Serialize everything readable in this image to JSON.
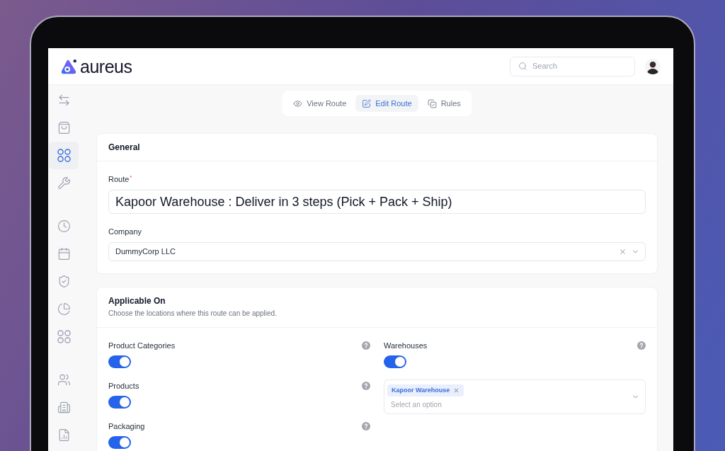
{
  "header": {
    "brand": "aureus",
    "search": {
      "placeholder": "Search"
    }
  },
  "sidebar": {
    "groups": [
      {
        "items": [
          {
            "selected": false
          },
          {
            "selected": false
          },
          {
            "selected": true
          },
          {
            "selected": false
          }
        ]
      },
      {
        "items": [
          {
            "selected": false
          },
          {
            "selected": false
          },
          {
            "selected": false
          },
          {
            "selected": false
          },
          {
            "selected": false
          }
        ]
      },
      {
        "items": [
          {
            "selected": false
          },
          {
            "selected": false
          },
          {
            "selected": false
          }
        ]
      }
    ]
  },
  "tabs": [
    {
      "label": "View Route",
      "selected": false
    },
    {
      "label": "Edit Route",
      "selected": true
    },
    {
      "label": "Rules",
      "selected": false
    }
  ],
  "general": {
    "title": "General",
    "fields": [
      {
        "kind": "text",
        "label": "Route",
        "required_mark": "*",
        "value": "Kapoor Warehouse : Deliver in 3 steps (Pick + Pack + Ship)"
      },
      {
        "kind": "select",
        "label": "Company",
        "value": "DummyCorp LLC"
      }
    ]
  },
  "applicable": {
    "title": "Applicable On",
    "subtitle": "Choose the locations where this route can be applied.",
    "columns": [
      {
        "items": [
          {
            "label": "Product Categories",
            "on": true
          },
          {
            "label": "Products",
            "on": true
          },
          {
            "label": "Packaging",
            "on": true
          }
        ]
      },
      {
        "items": [
          {
            "label": "Warehouses",
            "on": true,
            "picker": {
              "chips": [
                {
                  "label": "Kapoor Warehouse"
                }
              ],
              "placeholder": "Select an option"
            }
          }
        ]
      }
    ]
  }
}
